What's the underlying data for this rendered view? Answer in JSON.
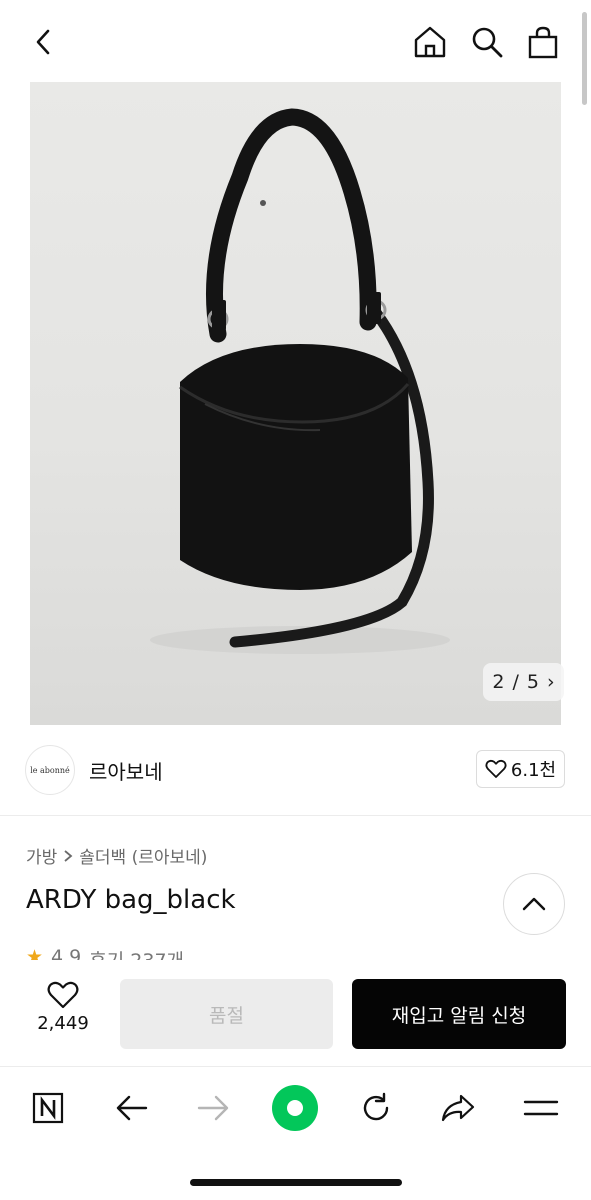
{
  "header": {
    "icons": [
      "chevron-left-icon",
      "home-icon",
      "search-icon",
      "shopping-bag-icon"
    ]
  },
  "gallery": {
    "current": "2",
    "separator": "/",
    "total": "5",
    "next_glyph": "›"
  },
  "store": {
    "logo_text": "le abonné",
    "name": "르아보네",
    "favorite_count": "6.1천"
  },
  "product": {
    "breadcrumb": [
      "가방",
      "숄더백 (르아보네)"
    ],
    "title": "ARDY bag_black",
    "rating": "4.9",
    "reviews_label": "후기 237개"
  },
  "actions": {
    "like_count": "2,449",
    "soldout_label": "품절",
    "restock_label": "재입고 알림 신청"
  },
  "browser_nav": {
    "icons": [
      "naver-n-icon",
      "back-arrow-icon",
      "forward-arrow-icon",
      "green-dot-icon",
      "refresh-icon",
      "share-icon",
      "menu-icon"
    ]
  },
  "colors": {
    "restock_button": "#050505",
    "soldout_button": "#ececec",
    "green_accent": "#03c75a",
    "star": "#f0a81b"
  }
}
